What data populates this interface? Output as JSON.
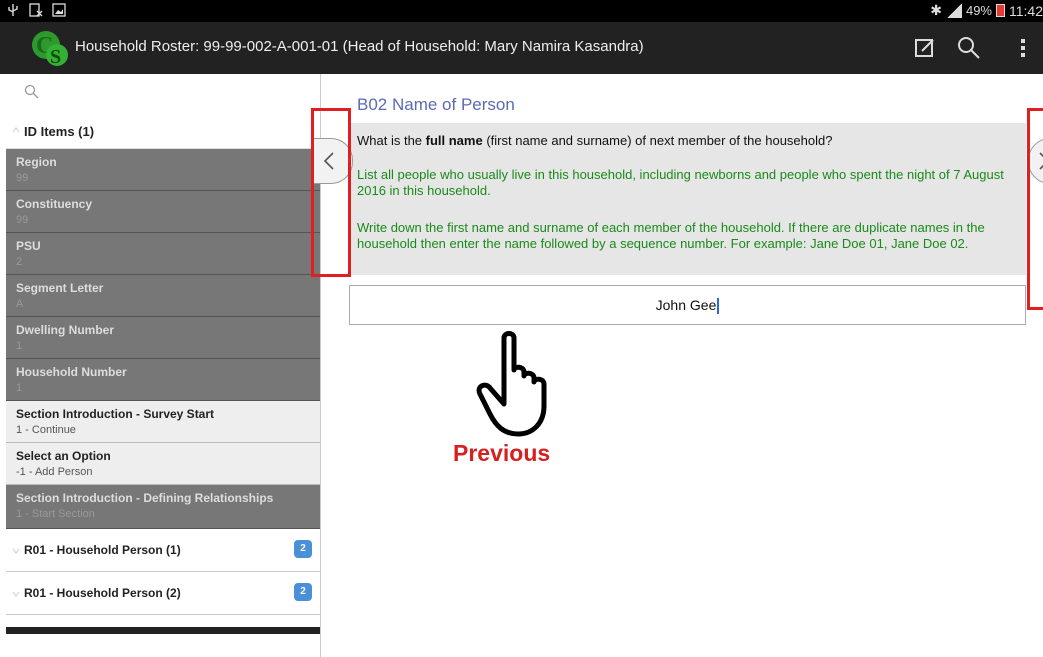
{
  "status_bar": {
    "battery": "49%",
    "time": "11:42"
  },
  "header": {
    "title": "Household Roster: 99-99-002-A-001-01 (Head of Household: Mary Namira Kasandra)"
  },
  "sidebar": {
    "section_label": "ID Items (1)",
    "items": [
      {
        "name": "Region",
        "value": "99"
      },
      {
        "name": "Constituency",
        "value": "99"
      },
      {
        "name": "PSU",
        "value": "2"
      },
      {
        "name": "Segment Letter",
        "value": "A"
      },
      {
        "name": "Dwelling Number",
        "value": "1"
      },
      {
        "name": "Household Number",
        "value": "1"
      },
      {
        "name": "Section Introduction - Survey Start",
        "value": "1 - Continue"
      },
      {
        "name": "Select an Option",
        "value": "-1 - Add Person"
      },
      {
        "name": "Section Introduction - Defining Relationships",
        "value": "1 - Start Section"
      }
    ],
    "groups": [
      {
        "label": "R01 - Household Person (1)",
        "badge": "2"
      },
      {
        "label": "R01 - Household Person (2)",
        "badge": "2"
      }
    ]
  },
  "question": {
    "title": "B02 Name of Person",
    "text_before": "What is the ",
    "text_bold": "full name",
    "text_after": " (first name and surname) of next member of the household?",
    "help1": "List all people who usually live in this household, including newborns and people who spent the night of 7 August 2016  in this household.",
    "help2": "Write down the first name and surname of each member of the household. If there are duplicate names in the household then enter the name followed by a sequence number. For example: Jane Doe 01, Jane Doe 02.",
    "answer": "John Gee"
  },
  "annotation": {
    "callout": "Previous"
  },
  "colors": {
    "title_blue": "#5b6bb5",
    "help_green": "#1a8a1a",
    "highlight_red": "#e02020",
    "badge_blue": "#4a90d9"
  }
}
